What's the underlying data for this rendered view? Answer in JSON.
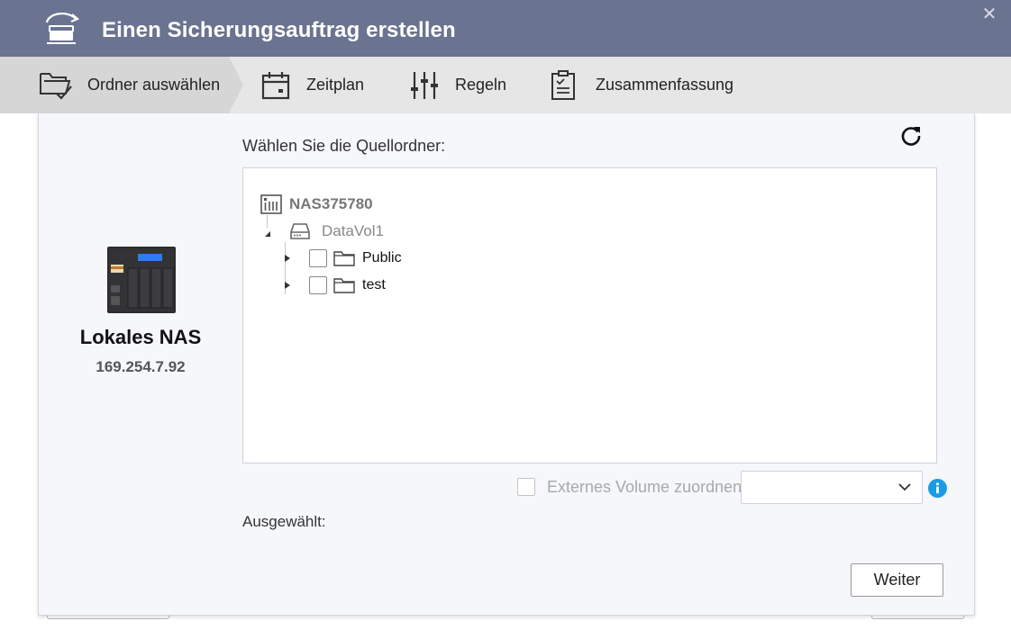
{
  "window": {
    "title": "Einen Sicherungsauftrag erstellen",
    "close_glyph": "✕"
  },
  "steps": [
    {
      "label": "Ordner auswählen",
      "icon": "folder-check-icon",
      "active": true
    },
    {
      "label": "Zeitplan",
      "icon": "calendar-icon",
      "active": false
    },
    {
      "label": "Regeln",
      "icon": "sliders-icon",
      "active": false
    },
    {
      "label": "Zusammenfassung",
      "icon": "clipboard-list-icon",
      "active": false
    }
  ],
  "device": {
    "name": "Lokales NAS",
    "ip": "169.254.7.92"
  },
  "source": {
    "label": "Wählen Sie die Quellordner:",
    "tree": {
      "root": "NAS375780",
      "volume": "DataVol1",
      "folders": [
        "Public",
        "test"
      ]
    }
  },
  "external_volume": {
    "label": "Externes Volume zuordnen",
    "selected_value": "",
    "enabled": false
  },
  "selected_label": "Ausgewählt:",
  "next_button": "Weiter",
  "colors": {
    "titlebar": "#6a7390",
    "stepbar": "#e6e6e6",
    "active_step": "#d6d6d6",
    "panel": "#f5f7fb",
    "info": "#1a9be6"
  }
}
